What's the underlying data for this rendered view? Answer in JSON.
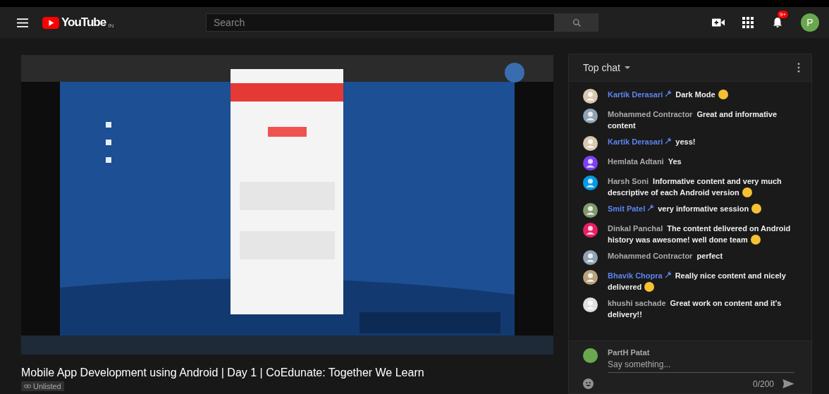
{
  "header": {
    "logo": "YouTube",
    "region": "IN",
    "search": {
      "placeholder": "Search"
    },
    "notifications": "9+",
    "avatar": {
      "letter": "P",
      "color": "#6aa84f"
    }
  },
  "title": "Mobile App Development using Android | Day 1 | CoEdunate: Together We Learn",
  "visibility": "Unlisted",
  "chat": {
    "heading": "Top chat",
    "messages": [
      {
        "author": "Kartik Derasari",
        "moderator": true,
        "text": "Dark Mode",
        "emoji": true,
        "color": "#d9c7b0"
      },
      {
        "author": "Mohammed Contractor",
        "moderator": false,
        "text": "Great and informative content",
        "emoji": false,
        "color": "#8fa3b5"
      },
      {
        "author": "Kartik Derasari",
        "moderator": true,
        "text": "yess!",
        "emoji": false,
        "color": "#d9c7b0"
      },
      {
        "author": "Hemlata Adtani",
        "moderator": false,
        "text": "Yes",
        "emoji": false,
        "color": "#7e3ff2"
      },
      {
        "author": "Harsh Soni",
        "moderator": false,
        "text": "Informative content and very much descriptive of each Android version",
        "emoji": true,
        "color": "#039be5"
      },
      {
        "author": "Smit Patel",
        "moderator": true,
        "text": "very informative session",
        "emoji": true,
        "color": "#7f9a6d"
      },
      {
        "author": "Dinkal Panchal",
        "moderator": false,
        "text": "The content delivered on Android history was awesome! well done team",
        "emoji": true,
        "color": "#e91e63"
      },
      {
        "author": "Mohammed Contractor",
        "moderator": false,
        "text": "perfect",
        "emoji": false,
        "color": "#8fa3b5"
      },
      {
        "author": "Bhavik Chopra",
        "moderator": true,
        "text": "Really nice content and nicely delivered",
        "emoji": true,
        "color": "#b8a27e"
      },
      {
        "author": "khushi sachade",
        "moderator": false,
        "text": "Great work on content and it's delivery!!",
        "emoji": false,
        "color": "#e0e0e0"
      }
    ],
    "composer": {
      "name": "PartH Patat",
      "color": "#6aa84f",
      "placeholder": "Say something...",
      "counter": "0/200"
    }
  }
}
